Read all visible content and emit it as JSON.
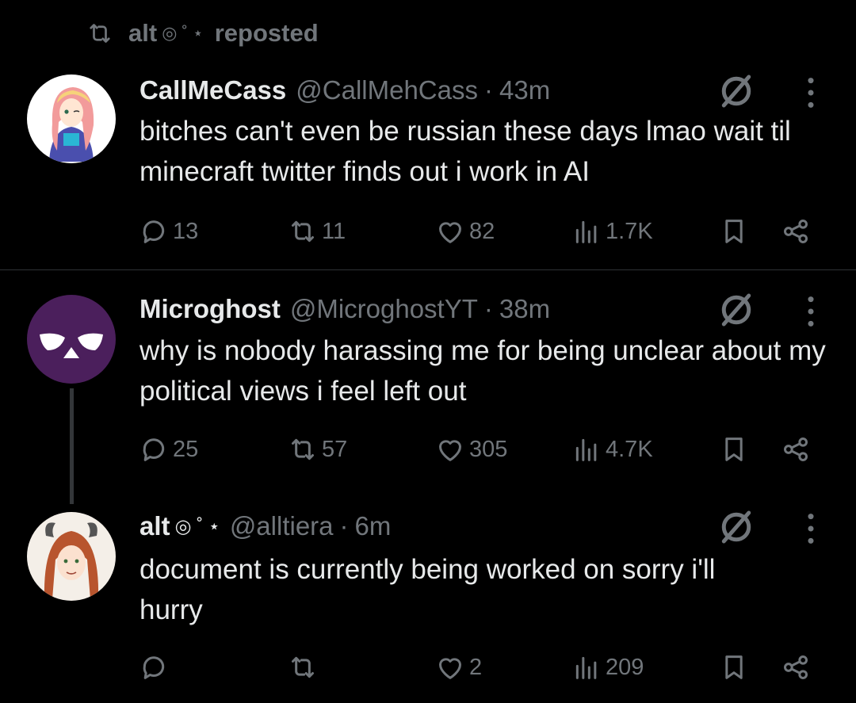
{
  "repost": {
    "user": "alt",
    "symbols": "◎ ˚ ⋆",
    "label": "reposted"
  },
  "tweets": [
    {
      "name": "CallMeCass",
      "name_symbols": "",
      "handle": "@CallMehCass",
      "time": "43m",
      "text": "bitches can't even be russian these days lmao wait til minecraft twitter finds out i work in AI",
      "replies": "13",
      "reposts": "11",
      "likes": "82",
      "views": "1.7K",
      "avatar_bg": "#ffffff"
    },
    {
      "name": "Microghost",
      "name_symbols": "",
      "handle": "@MicroghostYT",
      "time": "38m",
      "text": "why is nobody harassing me for being unclear about my political views i feel left out",
      "replies": "25",
      "reposts": "57",
      "likes": "305",
      "views": "4.7K",
      "avatar_bg": "#4b1f5c"
    },
    {
      "name": "alt",
      "name_symbols": "◎ ˚ ⋆",
      "handle": "@alltiera",
      "time": "6m",
      "text": "document is currently being worked on sorry i'll hurry",
      "replies": "",
      "reposts": "",
      "likes": "2",
      "views": "209",
      "avatar_bg": "#f4efe8"
    }
  ],
  "colors": {
    "background": "#000000",
    "text": "#e7e9ea",
    "muted": "#71767b",
    "divider": "#2f3336"
  }
}
